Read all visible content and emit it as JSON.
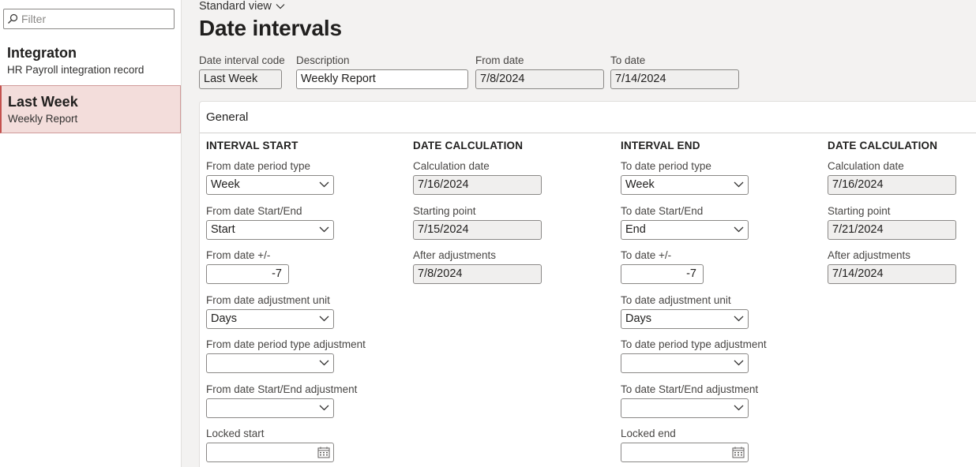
{
  "sidebar": {
    "filter_placeholder": "Filter",
    "records": [
      {
        "title": "Integraton",
        "subtitle": "HR Payroll integration record"
      },
      {
        "title": "Last Week",
        "subtitle": "Weekly Report"
      }
    ]
  },
  "header": {
    "view": "Standard view",
    "title": "Date intervals"
  },
  "top_fields": {
    "code": {
      "label": "Date interval code",
      "value": "Last Week"
    },
    "description": {
      "label": "Description",
      "value": "Weekly Report"
    },
    "from_date": {
      "label": "From date",
      "value": "7/8/2024"
    },
    "to_date": {
      "label": "To date",
      "value": "7/14/2024"
    }
  },
  "general": {
    "title": "General",
    "interval_start": {
      "heading": "INTERVAL START",
      "period_type": {
        "label": "From date period type",
        "value": "Week"
      },
      "start_end": {
        "label": "From date Start/End",
        "value": "Start"
      },
      "plus_minus": {
        "label": "From date +/-",
        "value": "-7"
      },
      "adj_unit": {
        "label": "From date adjustment unit",
        "value": "Days"
      },
      "period_type_adj": {
        "label": "From date period type adjustment",
        "value": ""
      },
      "start_end_adj": {
        "label": "From date Start/End adjustment",
        "value": ""
      },
      "locked": {
        "label": "Locked start",
        "value": ""
      }
    },
    "calc_start": {
      "heading": "DATE CALCULATION",
      "calc_date": {
        "label": "Calculation date",
        "value": "7/16/2024"
      },
      "starting_point": {
        "label": "Starting point",
        "value": "7/15/2024"
      },
      "after_adj": {
        "label": "After adjustments",
        "value": "7/8/2024"
      }
    },
    "interval_end": {
      "heading": "INTERVAL END",
      "period_type": {
        "label": "To date period type",
        "value": "Week"
      },
      "start_end": {
        "label": "To date Start/End",
        "value": "End"
      },
      "plus_minus": {
        "label": "To date +/-",
        "value": "-7"
      },
      "adj_unit": {
        "label": "To date adjustment unit",
        "value": "Days"
      },
      "period_type_adj": {
        "label": "To date period type adjustment",
        "value": ""
      },
      "start_end_adj": {
        "label": "To date Start/End adjustment",
        "value": ""
      },
      "locked": {
        "label": "Locked end",
        "value": ""
      }
    },
    "calc_end": {
      "heading": "DATE CALCULATION",
      "calc_date": {
        "label": "Calculation date",
        "value": "7/16/2024"
      },
      "starting_point": {
        "label": "Starting point",
        "value": "7/21/2024"
      },
      "after_adj": {
        "label": "After adjustments",
        "value": "7/14/2024"
      }
    }
  },
  "colors": {
    "selected_bg": "#f3dddb",
    "selected_accent": "#c4514e",
    "readonly_bg": "#f0efee"
  },
  "icons": [
    "search-icon",
    "chevron-down-icon",
    "calendar-icon"
  ]
}
